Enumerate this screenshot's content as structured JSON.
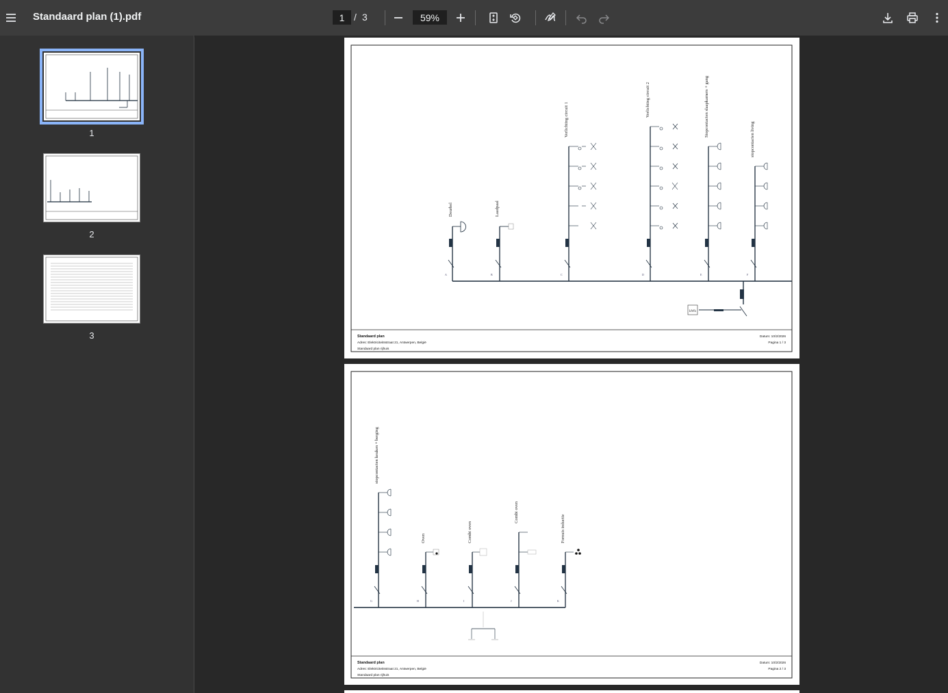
{
  "toolbar": {
    "menu_icon": "menu-icon",
    "title": "Standaard plan (1).pdf",
    "current_page": "1",
    "page_separator": "/",
    "total_pages": "3",
    "zoom": "59%"
  },
  "thumbnails": [
    {
      "number": "1",
      "selected": true
    },
    {
      "number": "2",
      "selected": false
    },
    {
      "number": "3",
      "selected": false
    }
  ],
  "pages": [
    {
      "footer": {
        "title": "Standaard plan",
        "address": "Adres: Elektriciteitsstraat 21, Antwerpen, België",
        "subtitle": "Standaard plan rijhuis",
        "date": "Datum: 10/2/2026",
        "page": "Pagina 1 / 3"
      },
      "circuits": [
        {
          "label": "Deurbel",
          "letter": "A"
        },
        {
          "label": "Laadpaal",
          "letter": "B"
        },
        {
          "label": "Verlichting circuit 1",
          "letter": "C"
        },
        {
          "label": "Verlichting circuit 2",
          "letter": "D"
        },
        {
          "label": "Stopcontacten slaapkamers + gang",
          "letter": "E"
        },
        {
          "label": "stopcontacten living",
          "letter": "F"
        }
      ],
      "meter_label": "kWh"
    },
    {
      "footer": {
        "title": "Standaard plan",
        "address": "Adres: Elektriciteitsstraat 21, Antwerpen, België",
        "subtitle": "Standaard plan rijhuis",
        "date": "Datum: 10/2/2026",
        "page": "Pagina 2 / 3"
      },
      "circuits": [
        {
          "label": "stopcontacten keuken + berging",
          "letter": "G"
        },
        {
          "label": "Oven",
          "letter": "H"
        },
        {
          "label": "Combi oven",
          "letter": "I"
        },
        {
          "label": "Combi oven",
          "letter": "J"
        },
        {
          "label": "Fornuis inductie",
          "letter": "K"
        }
      ]
    }
  ]
}
